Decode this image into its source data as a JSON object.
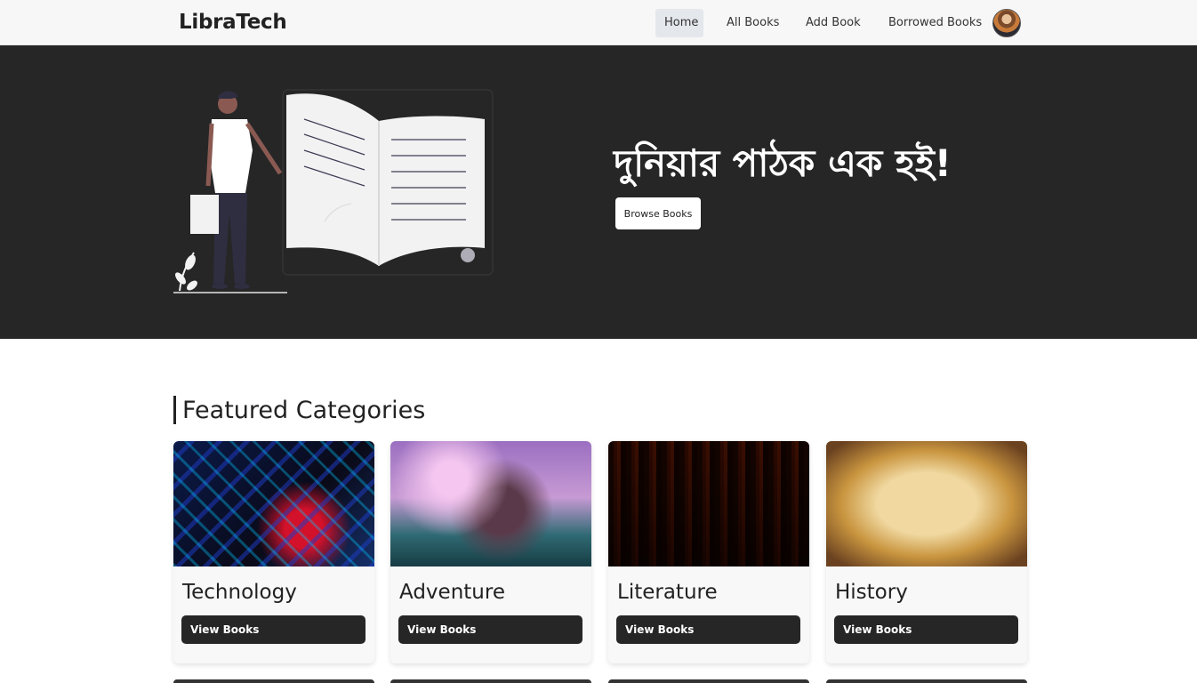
{
  "nav": {
    "brand": "LibraTech",
    "items": [
      {
        "label": "Home",
        "active": true
      },
      {
        "label": "All Books",
        "active": false
      },
      {
        "label": "Add Book",
        "active": false
      },
      {
        "label": "Borrowed Books",
        "active": false
      }
    ],
    "avatar_icon": "user-avatar"
  },
  "hero": {
    "title": "দুনিয়ার পাঠক এক হই!",
    "button_label": "Browse Books",
    "illustration_icon": "reading-person-book-illustration",
    "background": "#262626"
  },
  "featured": {
    "title": "Featured Categories",
    "categories": [
      {
        "name": "Technology",
        "button_label": "View Books"
      },
      {
        "name": "Adventure",
        "button_label": "View Books"
      },
      {
        "name": "Literature",
        "button_label": "View Books"
      },
      {
        "name": "History",
        "button_label": "View Books"
      }
    ]
  },
  "colors": {
    "navbar_bg": "#f7f7f7",
    "dark": "#262626",
    "accent_active": "#e4e7ec"
  }
}
